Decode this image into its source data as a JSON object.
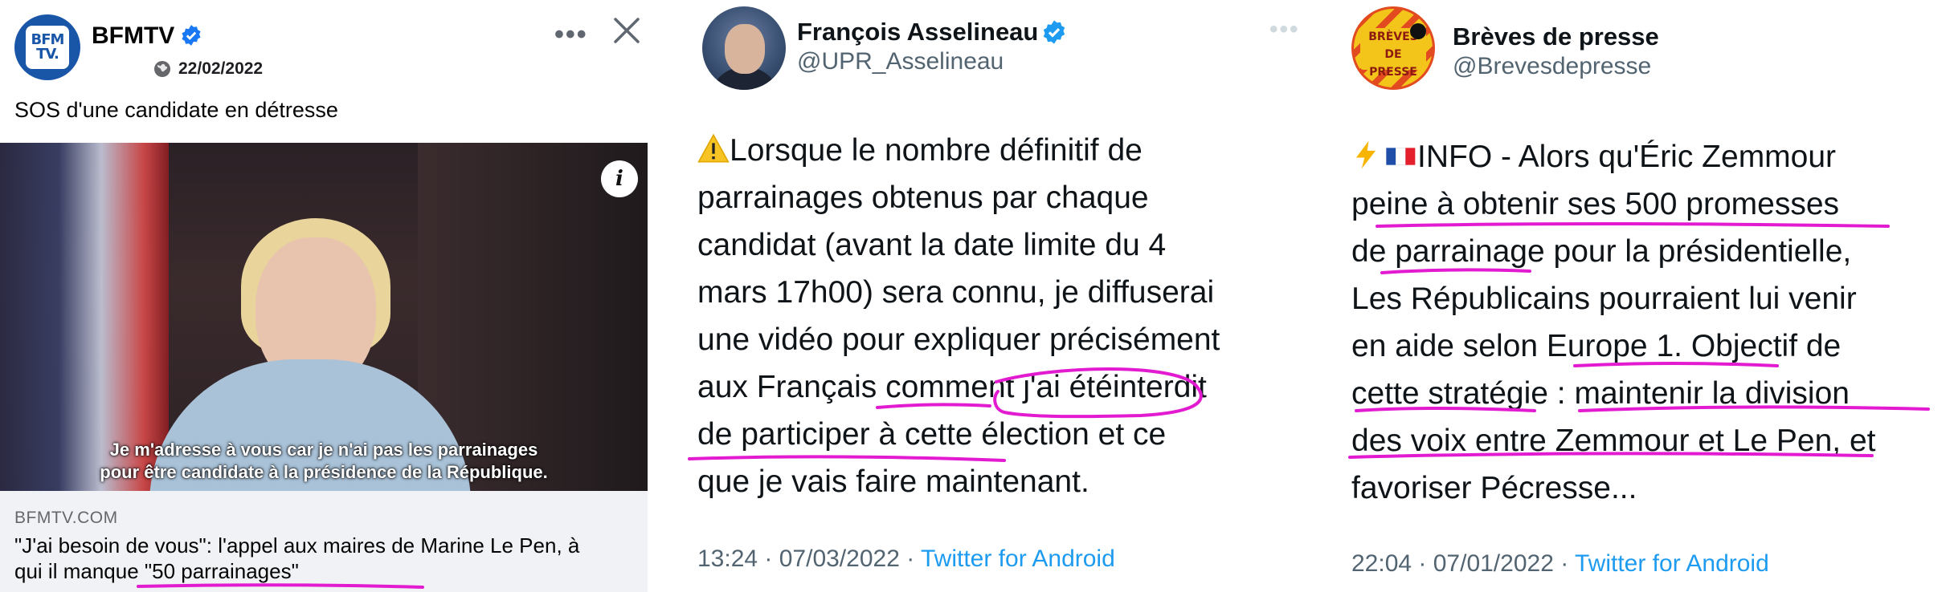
{
  "fb_post": {
    "page_name": "BFMTV",
    "avatar_text_line1": "BFM",
    "avatar_text_line2": "TV.",
    "date": "22/02/2022",
    "more_icon": "more-icon",
    "close_icon": "close-icon",
    "caption": "SOS d'une candidate en détresse",
    "video_subtitle_line1": "Je m'adresse à vous car je n'ai pas les parrainages",
    "video_subtitle_line2": "pour être candidate à la présidence de la République.",
    "info_icon": "i",
    "link_domain": "BFMTV.COM",
    "link_headline_part1": "\"J'ai besoin de vous\": l'appel aux maires de Marine Le Pen, à qui il ",
    "link_headline_part2": "manque \"50 parrainages\""
  },
  "tweet_asselineau": {
    "display_name": "François Asselineau",
    "handle": "@UPR_Asselineau",
    "lines": [
      "Lorsque le nombre définitif de",
      "parrainages obtenus par chaque",
      "candidat (avant la date limite du 4",
      "mars 17h00) sera connu, je diffuserai",
      "une vidéo pour expliquer précisément"
    ],
    "line6_a": "aux Français comment ",
    "line6_b": "j'ai été",
    "line6_c": "interdit",
    "line7_a": "de participer à cette élection",
    "line7_b": " et ce",
    "line8": "que je vais faire maintenant.",
    "time": "13:24 · 07/03/2022 · ",
    "source": "Twitter for Android"
  },
  "tweet_breves": {
    "display_name": "Brèves de presse",
    "handle": "@Brevesdepresse",
    "avatar_text_line1": "BRÈVES",
    "avatar_text_line2": "DE PRESSE",
    "line1": "INFO - Alors qu'Éric Zemmour",
    "line2": "peine à obtenir ses 500 promesses",
    "line3_a": "de ",
    "line3_b": "parrainage",
    "line3_c": " pour la présidentielle,",
    "line4": "Les Républicains pourraient lui venir",
    "line5_a": "en aide selon Europe 1. ",
    "line5_b": "Objectif de",
    "line6_a": "cette stratégie",
    "line6_b": " : ",
    "line6_c": "maintenir la division",
    "line7_a": "des voix entre Zemmour et Le Pen",
    "line7_b": ", et",
    "line8": "favoriser Pécresse...",
    "time": "22:04 · 07/01/2022 · ",
    "source": "Twitter for Android"
  },
  "colors": {
    "annotation": "#e31bd0",
    "twitter_blue": "#1d9bf0",
    "bfm_blue": "#1a56a8"
  }
}
